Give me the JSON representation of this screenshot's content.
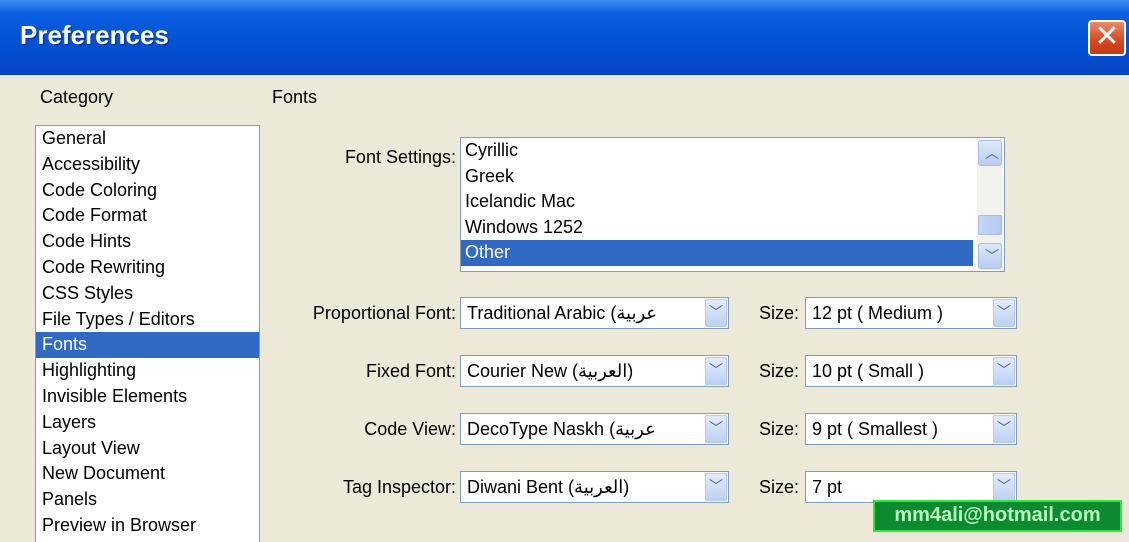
{
  "window": {
    "title": "Preferences",
    "close_icon": "close-icon"
  },
  "category": {
    "label": "Category",
    "items": [
      {
        "label": "General"
      },
      {
        "label": "Accessibility"
      },
      {
        "label": "Code Coloring"
      },
      {
        "label": "Code Format"
      },
      {
        "label": "Code Hints"
      },
      {
        "label": "Code Rewriting"
      },
      {
        "label": "CSS Styles"
      },
      {
        "label": "File Types / Editors"
      },
      {
        "label": "Fonts",
        "selected": true
      },
      {
        "label": "Highlighting"
      },
      {
        "label": "Invisible Elements"
      },
      {
        "label": "Layers"
      },
      {
        "label": "Layout View"
      },
      {
        "label": "New Document"
      },
      {
        "label": "Panels"
      },
      {
        "label": "Preview in Browser"
      }
    ]
  },
  "fonts": {
    "section_title": "Fonts",
    "font_settings": {
      "label": "Font Settings:",
      "items": [
        {
          "label": "Cyrillic"
        },
        {
          "label": "Greek"
        },
        {
          "label": "Icelandic Mac"
        },
        {
          "label": "Windows 1252"
        },
        {
          "label": "Other",
          "selected": true
        }
      ]
    },
    "rows": [
      {
        "label": "Proportional Font:",
        "font": "Traditional Arabic (عربية",
        "size_label": "Size:",
        "size": "12 pt  ( Medium )"
      },
      {
        "label": "Fixed Font:",
        "font": "Courier New (العربية)",
        "size_label": "Size:",
        "size": "10 pt  ( Small )"
      },
      {
        "label": "Code View:",
        "font": "DecoType Naskh (عربية",
        "size_label": "Size:",
        "size": "9 pt     ( Smallest )"
      },
      {
        "label": "Tag Inspector:",
        "font": "Diwani Bent (العربية)",
        "size_label": "Size:",
        "size": "7 pt"
      }
    ]
  },
  "watermark": {
    "text": "mm4ali@hotmail.com"
  },
  "colors": {
    "title_bar": "#0352d6",
    "selection": "#316ac5",
    "dialog_bg": "#ece9d8",
    "close_button": "#d4471f"
  }
}
